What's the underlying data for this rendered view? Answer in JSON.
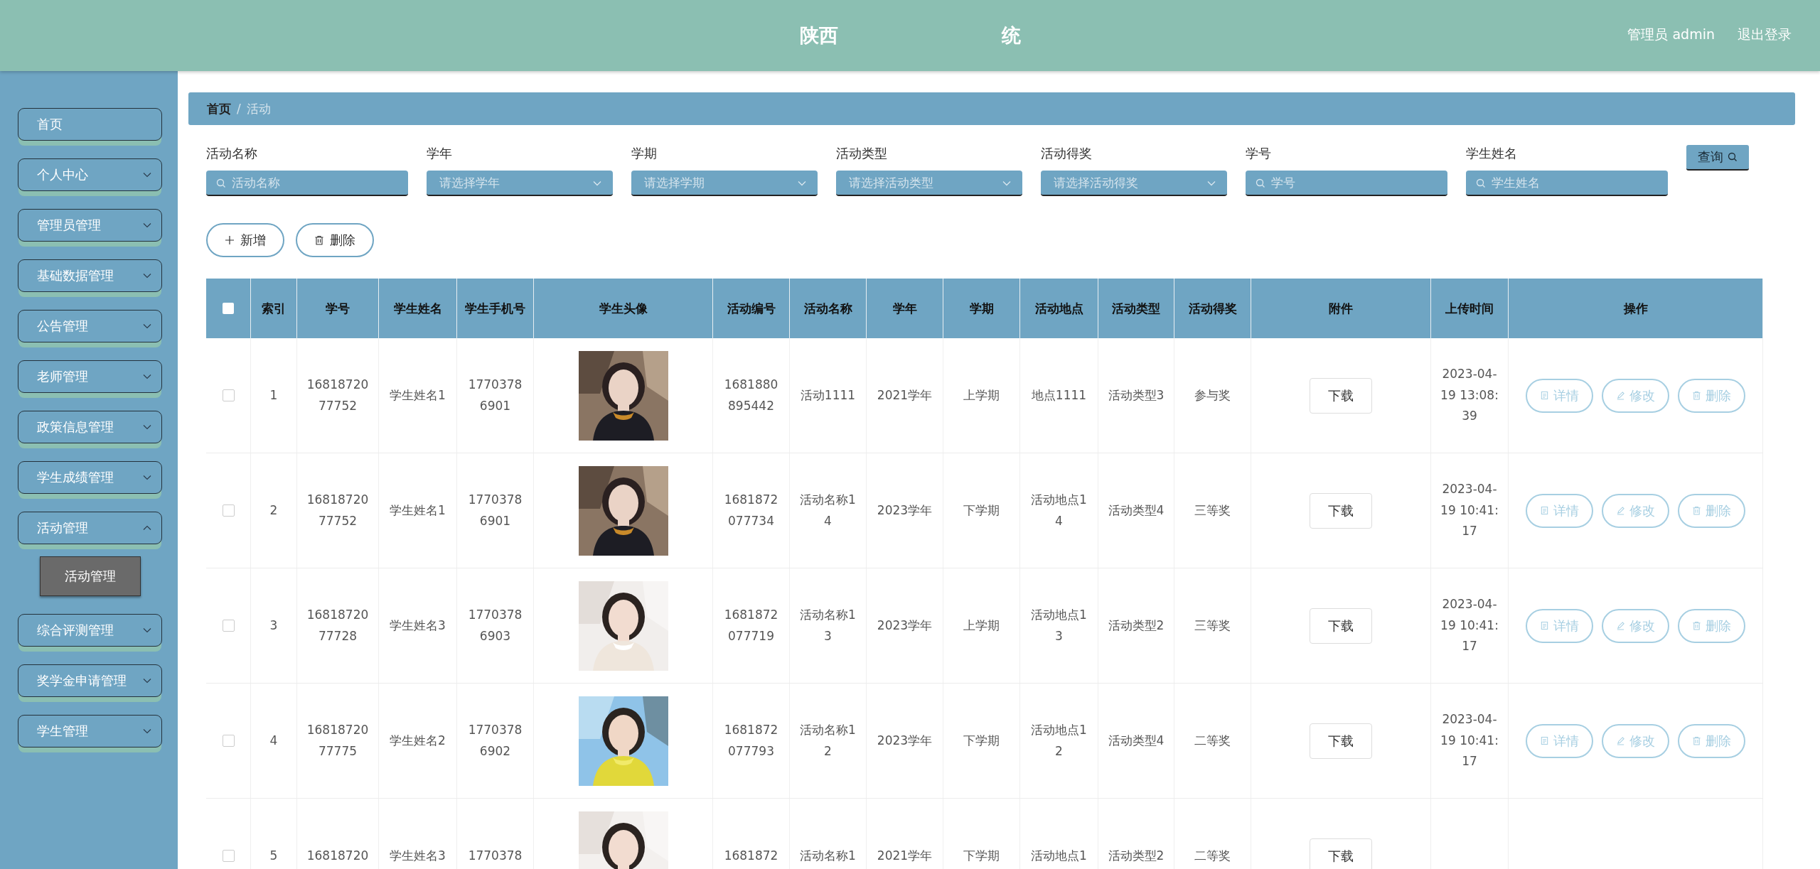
{
  "header": {
    "title_parts": [
      "陕西",
      "统"
    ],
    "user": "管理员 admin",
    "logout": "退出登录"
  },
  "sidebar": {
    "items": [
      {
        "label": "首页",
        "kind": "link"
      },
      {
        "label": "个人中心",
        "kind": "menu",
        "expanded": false
      },
      {
        "label": "管理员管理",
        "kind": "menu",
        "expanded": false
      },
      {
        "label": "基础数据管理",
        "kind": "menu",
        "expanded": false
      },
      {
        "label": "公告管理",
        "kind": "menu",
        "expanded": false
      },
      {
        "label": "老师管理",
        "kind": "menu",
        "expanded": false
      },
      {
        "label": "政策信息管理",
        "kind": "menu",
        "expanded": false
      },
      {
        "label": "学生成绩管理",
        "kind": "menu",
        "expanded": false
      },
      {
        "label": "活动管理",
        "kind": "menu",
        "expanded": true,
        "children": [
          {
            "label": "活动管理",
            "selected": true
          }
        ]
      },
      {
        "label": "综合评测管理",
        "kind": "menu",
        "expanded": false
      },
      {
        "label": "奖学金申请管理",
        "kind": "menu",
        "expanded": false
      },
      {
        "label": "学生管理",
        "kind": "menu",
        "expanded": false
      }
    ]
  },
  "breadcrumb": [
    "首页",
    "/",
    "活动"
  ],
  "filters": [
    {
      "label": "活动名称",
      "kind": "text",
      "placeholder": "活动名称"
    },
    {
      "label": "学年",
      "kind": "select",
      "placeholder": "请选择学年"
    },
    {
      "label": "学期",
      "kind": "select",
      "placeholder": "请选择学期"
    },
    {
      "label": "活动类型",
      "kind": "select",
      "placeholder": "请选择活动类型"
    },
    {
      "label": "活动得奖",
      "kind": "select",
      "placeholder": "请选择活动得奖"
    },
    {
      "label": "学号",
      "kind": "text",
      "placeholder": "学号"
    },
    {
      "label": "学生姓名",
      "kind": "text",
      "placeholder": "学生姓名"
    }
  ],
  "search_button": "查询",
  "actions": [
    {
      "label": "新增",
      "kind": "add"
    },
    {
      "label": "删除",
      "kind": "delete"
    }
  ],
  "table": {
    "columns": [
      "索引",
      "学号",
      "学生姓名",
      "学生手机号",
      "学生头像",
      "活动编号",
      "活动名称",
      "学年",
      "学期",
      "活动地点",
      "活动类型",
      "活动得奖",
      "附件",
      "上传时间",
      "操作"
    ],
    "select_all_checked": false,
    "rows": [
      {
        "checked": false,
        "cells": [
          "1",
          "1681872077752",
          "学生姓名1",
          "17703786901",
          "",
          "1681880895442",
          "活动1111",
          "2021学年",
          "上学期",
          "地点1111",
          "活动类型3",
          "参与奖",
          "下载",
          "2023-04-19 13:08:39"
        ],
        "actions": [
          {
            "label": "详情",
            "kind": "detail"
          },
          {
            "label": "修改",
            "kind": "edit"
          },
          {
            "label": "删除",
            "kind": "delete"
          }
        ]
      },
      {
        "checked": false,
        "cells": [
          "2",
          "1681872077752",
          "学生姓名1",
          "17703786901",
          "",
          "1681872077734",
          "活动名称14",
          "2023学年",
          "下学期",
          "活动地点14",
          "活动类型4",
          "三等奖",
          "下载",
          "2023-04-19 10:41:17"
        ],
        "actions": [
          {
            "label": "详情",
            "kind": "detail"
          },
          {
            "label": "修改",
            "kind": "edit"
          },
          {
            "label": "删除",
            "kind": "delete"
          }
        ]
      },
      {
        "checked": false,
        "cells": [
          "3",
          "1681872077728",
          "学生姓名3",
          "17703786903",
          "",
          "1681872077719",
          "活动名称13",
          "2023学年",
          "上学期",
          "活动地点13",
          "活动类型2",
          "三等奖",
          "下载",
          "2023-04-19 10:41:17"
        ],
        "actions": [
          {
            "label": "详情",
            "kind": "detail"
          },
          {
            "label": "修改",
            "kind": "edit"
          },
          {
            "label": "删除",
            "kind": "delete"
          }
        ]
      },
      {
        "checked": false,
        "cells": [
          "4",
          "1681872077775",
          "学生姓名2",
          "17703786902",
          "",
          "1681872077793",
          "活动名称12",
          "2023学年",
          "下学期",
          "活动地点12",
          "活动类型4",
          "二等奖",
          "下载",
          "2023-04-19 10:41:17"
        ],
        "actions": [
          {
            "label": "详情",
            "kind": "detail"
          },
          {
            "label": "修改",
            "kind": "edit"
          },
          {
            "label": "删除",
            "kind": "delete"
          }
        ]
      },
      {
        "checked": false,
        "cells": [
          "5",
          "16818720",
          "学生姓名3",
          "1770378",
          "",
          "1681872",
          "活动名称1",
          "2021学年",
          "下学期",
          "活动地点1",
          "活动类型2",
          "二等奖",
          "下载"
        ]
      }
    ]
  }
}
